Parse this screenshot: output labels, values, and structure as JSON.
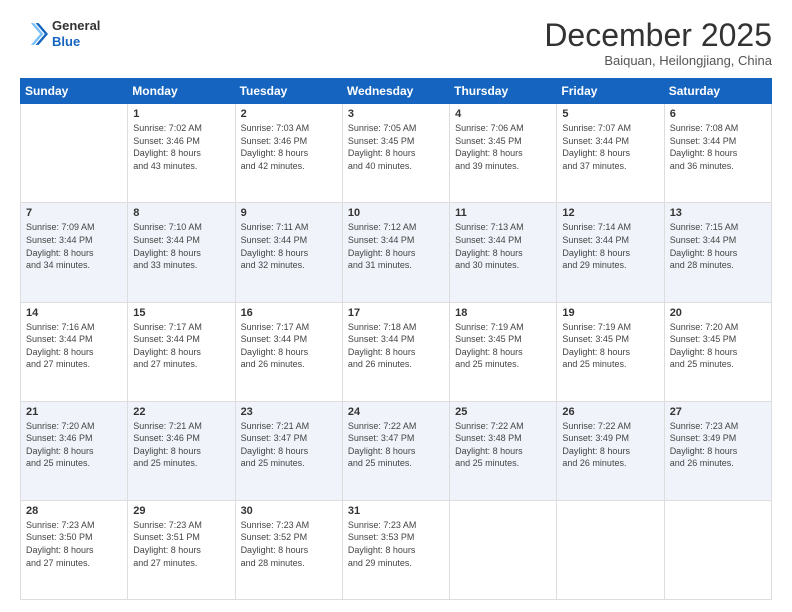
{
  "logo": {
    "line1": "General",
    "line2": "Blue"
  },
  "header": {
    "month": "December 2025",
    "location": "Baiquan, Heilongjiang, China"
  },
  "days_of_week": [
    "Sunday",
    "Monday",
    "Tuesday",
    "Wednesday",
    "Thursday",
    "Friday",
    "Saturday"
  ],
  "weeks": [
    [
      {
        "day": "",
        "info": ""
      },
      {
        "day": "1",
        "info": "Sunrise: 7:02 AM\nSunset: 3:46 PM\nDaylight: 8 hours\nand 43 minutes."
      },
      {
        "day": "2",
        "info": "Sunrise: 7:03 AM\nSunset: 3:46 PM\nDaylight: 8 hours\nand 42 minutes."
      },
      {
        "day": "3",
        "info": "Sunrise: 7:05 AM\nSunset: 3:45 PM\nDaylight: 8 hours\nand 40 minutes."
      },
      {
        "day": "4",
        "info": "Sunrise: 7:06 AM\nSunset: 3:45 PM\nDaylight: 8 hours\nand 39 minutes."
      },
      {
        "day": "5",
        "info": "Sunrise: 7:07 AM\nSunset: 3:44 PM\nDaylight: 8 hours\nand 37 minutes."
      },
      {
        "day": "6",
        "info": "Sunrise: 7:08 AM\nSunset: 3:44 PM\nDaylight: 8 hours\nand 36 minutes."
      }
    ],
    [
      {
        "day": "7",
        "info": "Sunrise: 7:09 AM\nSunset: 3:44 PM\nDaylight: 8 hours\nand 34 minutes."
      },
      {
        "day": "8",
        "info": "Sunrise: 7:10 AM\nSunset: 3:44 PM\nDaylight: 8 hours\nand 33 minutes."
      },
      {
        "day": "9",
        "info": "Sunrise: 7:11 AM\nSunset: 3:44 PM\nDaylight: 8 hours\nand 32 minutes."
      },
      {
        "day": "10",
        "info": "Sunrise: 7:12 AM\nSunset: 3:44 PM\nDaylight: 8 hours\nand 31 minutes."
      },
      {
        "day": "11",
        "info": "Sunrise: 7:13 AM\nSunset: 3:44 PM\nDaylight: 8 hours\nand 30 minutes."
      },
      {
        "day": "12",
        "info": "Sunrise: 7:14 AM\nSunset: 3:44 PM\nDaylight: 8 hours\nand 29 minutes."
      },
      {
        "day": "13",
        "info": "Sunrise: 7:15 AM\nSunset: 3:44 PM\nDaylight: 8 hours\nand 28 minutes."
      }
    ],
    [
      {
        "day": "14",
        "info": "Sunrise: 7:16 AM\nSunset: 3:44 PM\nDaylight: 8 hours\nand 27 minutes."
      },
      {
        "day": "15",
        "info": "Sunrise: 7:17 AM\nSunset: 3:44 PM\nDaylight: 8 hours\nand 27 minutes."
      },
      {
        "day": "16",
        "info": "Sunrise: 7:17 AM\nSunset: 3:44 PM\nDaylight: 8 hours\nand 26 minutes."
      },
      {
        "day": "17",
        "info": "Sunrise: 7:18 AM\nSunset: 3:44 PM\nDaylight: 8 hours\nand 26 minutes."
      },
      {
        "day": "18",
        "info": "Sunrise: 7:19 AM\nSunset: 3:45 PM\nDaylight: 8 hours\nand 25 minutes."
      },
      {
        "day": "19",
        "info": "Sunrise: 7:19 AM\nSunset: 3:45 PM\nDaylight: 8 hours\nand 25 minutes."
      },
      {
        "day": "20",
        "info": "Sunrise: 7:20 AM\nSunset: 3:45 PM\nDaylight: 8 hours\nand 25 minutes."
      }
    ],
    [
      {
        "day": "21",
        "info": "Sunrise: 7:20 AM\nSunset: 3:46 PM\nDaylight: 8 hours\nand 25 minutes."
      },
      {
        "day": "22",
        "info": "Sunrise: 7:21 AM\nSunset: 3:46 PM\nDaylight: 8 hours\nand 25 minutes."
      },
      {
        "day": "23",
        "info": "Sunrise: 7:21 AM\nSunset: 3:47 PM\nDaylight: 8 hours\nand 25 minutes."
      },
      {
        "day": "24",
        "info": "Sunrise: 7:22 AM\nSunset: 3:47 PM\nDaylight: 8 hours\nand 25 minutes."
      },
      {
        "day": "25",
        "info": "Sunrise: 7:22 AM\nSunset: 3:48 PM\nDaylight: 8 hours\nand 25 minutes."
      },
      {
        "day": "26",
        "info": "Sunrise: 7:22 AM\nSunset: 3:49 PM\nDaylight: 8 hours\nand 26 minutes."
      },
      {
        "day": "27",
        "info": "Sunrise: 7:23 AM\nSunset: 3:49 PM\nDaylight: 8 hours\nand 26 minutes."
      }
    ],
    [
      {
        "day": "28",
        "info": "Sunrise: 7:23 AM\nSunset: 3:50 PM\nDaylight: 8 hours\nand 27 minutes."
      },
      {
        "day": "29",
        "info": "Sunrise: 7:23 AM\nSunset: 3:51 PM\nDaylight: 8 hours\nand 27 minutes."
      },
      {
        "day": "30",
        "info": "Sunrise: 7:23 AM\nSunset: 3:52 PM\nDaylight: 8 hours\nand 28 minutes."
      },
      {
        "day": "31",
        "info": "Sunrise: 7:23 AM\nSunset: 3:53 PM\nDaylight: 8 hours\nand 29 minutes."
      },
      {
        "day": "",
        "info": ""
      },
      {
        "day": "",
        "info": ""
      },
      {
        "day": "",
        "info": ""
      }
    ]
  ]
}
